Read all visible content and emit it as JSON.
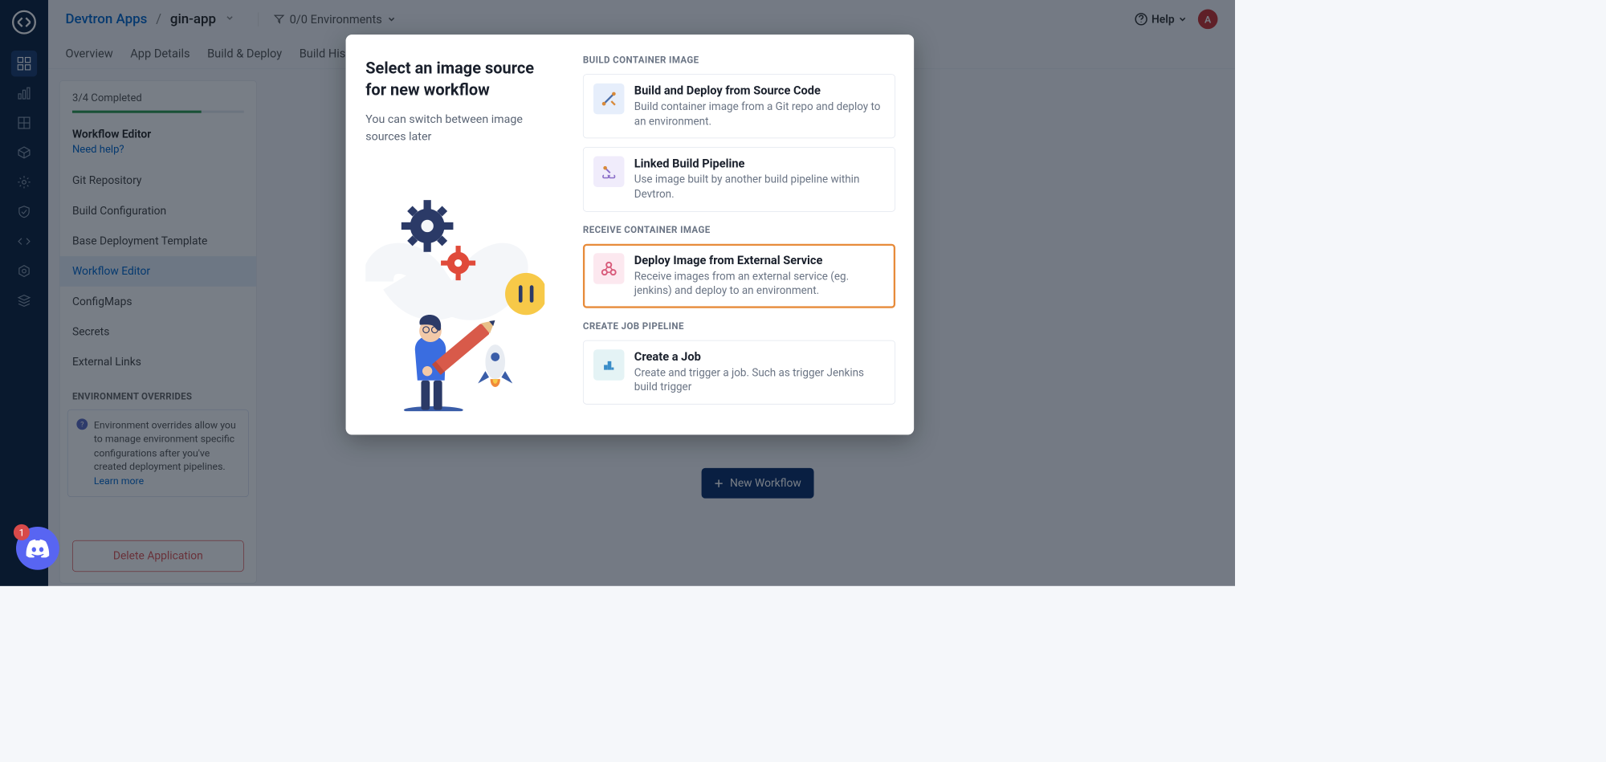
{
  "header": {
    "breadcrumb_root": "Devtron Apps",
    "breadcrumb_app": "gin-app",
    "env_label": "0/0 Environments",
    "help_label": "Help",
    "avatar_initial": "A"
  },
  "tabs": [
    "Overview",
    "App Details",
    "Build & Deploy",
    "Build His"
  ],
  "side_panel": {
    "progress": "3/4 Completed",
    "title": "Workflow Editor",
    "need_help": "Need help?",
    "items": [
      "Git Repository",
      "Build Configuration",
      "Base Deployment Template",
      "Workflow Editor",
      "ConfigMaps",
      "Secrets",
      "External Links"
    ],
    "overrides_header": "ENVIRONMENT OVERRIDES",
    "overrides_info": "Environment overrides allow you to manage environment specific configurations after you've created deployment pipelines.",
    "learn_more": "Learn more",
    "delete_btn": "Delete Application"
  },
  "new_workflow_btn": "New Workflow",
  "discord_badge": "1",
  "modal": {
    "title": "Select an image source for new workflow",
    "subtitle": "You can switch between image sources later",
    "sections": {
      "build": {
        "label": "BUILD CONTAINER IMAGE",
        "options": [
          {
            "title": "Build and Deploy from Source Code",
            "desc": "Build container image from a Git repo and deploy to an environment."
          },
          {
            "title": "Linked Build Pipeline",
            "desc": "Use image built by another build pipeline within Devtron."
          }
        ]
      },
      "receive": {
        "label": "RECEIVE CONTAINER IMAGE",
        "options": [
          {
            "title": "Deploy Image from External Service",
            "desc": "Receive images from an external service (eg. jenkins) and deploy to an environment."
          }
        ]
      },
      "job": {
        "label": "CREATE JOB PIPELINE",
        "options": [
          {
            "title": "Create a Job",
            "desc": "Create and trigger a job. Such as trigger Jenkins build trigger"
          }
        ]
      }
    }
  }
}
